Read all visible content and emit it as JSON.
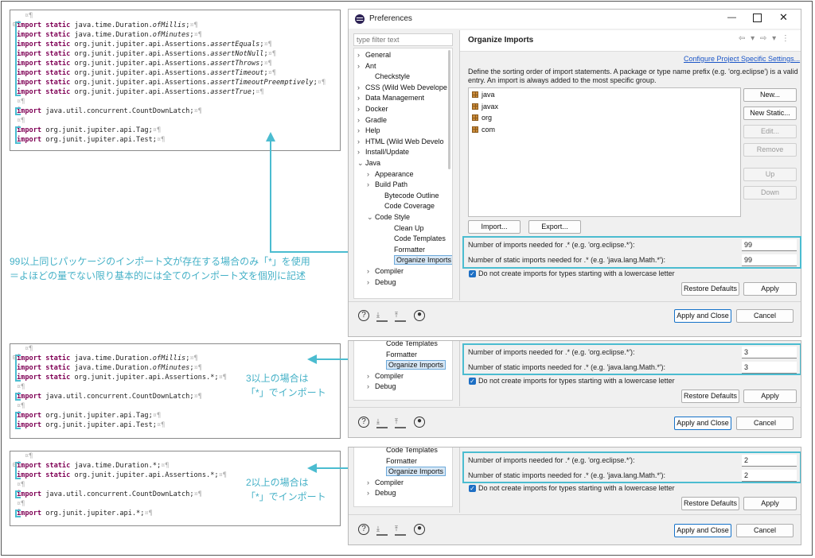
{
  "panels": {
    "p1_lines": [
      {
        "kw": "import",
        "kw2": "static",
        "pre": "java.time.Duration.",
        "it": "ofMillis",
        "post": ";"
      },
      {
        "kw": "import",
        "kw2": "static",
        "pre": "java.time.Duration.",
        "it": "ofMinutes",
        "post": ";"
      },
      {
        "kw": "import",
        "kw2": "static",
        "pre": "org.junit.jupiter.api.Assertions.",
        "it": "assertEquals",
        "post": ";"
      },
      {
        "kw": "import",
        "kw2": "static",
        "pre": "org.junit.jupiter.api.Assertions.",
        "it": "assertNotNull",
        "post": ";"
      },
      {
        "kw": "import",
        "kw2": "static",
        "pre": "org.junit.jupiter.api.Assertions.",
        "it": "assertThrows",
        "post": ";"
      },
      {
        "kw": "import",
        "kw2": "static",
        "pre": "org.junit.jupiter.api.Assertions.",
        "it": "assertTimeout",
        "post": ";"
      },
      {
        "kw": "import",
        "kw2": "static",
        "pre": "org.junit.jupiter.api.Assertions.",
        "it": "assertTimeoutPreemptively",
        "post": ";"
      },
      {
        "kw": "import",
        "kw2": "static",
        "pre": "org.junit.jupiter.api.Assertions.",
        "it": "assertTrue",
        "post": ";"
      },
      {
        "blank": true
      },
      {
        "kw": "import",
        "pre": "java.util.concurrent.CountDownLatch;"
      },
      {
        "blank": true
      },
      {
        "kw": "import",
        "pre": "org.junit.jupiter.api.Tag;"
      },
      {
        "kw": "import",
        "pre": "org.junit.jupiter.api.Test;"
      }
    ],
    "p2_lines": [
      {
        "kw": "import",
        "kw2": "static",
        "pre": "java.time.Duration.",
        "it": "ofMillis",
        "post": ";"
      },
      {
        "kw": "import",
        "kw2": "static",
        "pre": "java.time.Duration.",
        "it": "ofMinutes",
        "post": ";"
      },
      {
        "kw": "import",
        "kw2": "static",
        "pre": "org.junit.jupiter.api.Assertions.*;"
      },
      {
        "blank": true
      },
      {
        "kw": "import",
        "pre": "java.util.concurrent.CountDownLatch;"
      },
      {
        "blank": true
      },
      {
        "kw": "import",
        "pre": "org.junit.jupiter.api.Tag;"
      },
      {
        "kw": "import",
        "pre": "org.junit.jupiter.api.Test;"
      }
    ],
    "p3_lines": [
      {
        "kw": "import",
        "kw2": "static",
        "pre": "java.time.Duration.*;"
      },
      {
        "kw": "import",
        "kw2": "static",
        "pre": "org.junit.jupiter.api.Assertions.*;"
      },
      {
        "blank": true
      },
      {
        "kw": "import",
        "pre": "java.util.concurrent.CountDownLatch;"
      },
      {
        "blank": true
      },
      {
        "kw": "import",
        "pre": "org.junit.jupiter.api.*;"
      }
    ],
    "pilcrow": "¶",
    "cr": "¤¶",
    "minus": "⊟"
  },
  "notes": {
    "note1_line1": "99以上同じパッケージのインポート文が存在する場合のみ「*」を使用",
    "note1_line2": "＝よほどの量でない限り基本的には全てのインポート文を個別に記述",
    "note2_line1": "3以上の場合は",
    "note2_line2": "「*」でインポート",
    "note3_line1": "2以上の場合は",
    "note3_line2": "「*」でインポート"
  },
  "window": {
    "title": "Preferences",
    "filter_placeholder": "type filter text",
    "page_title": "Organize Imports",
    "config_link": "Configure Project Specific Settings...",
    "description": "Define the sorting order of import statements. A package or type name prefix (e.g. 'org.eclipse') is a valid entry. An import is always added to the most specific group.",
    "tree": [
      {
        "label": "General",
        "arrow": "›"
      },
      {
        "label": "Ant",
        "arrow": "›"
      },
      {
        "label": "Checkstyle",
        "arrow": ""
      },
      {
        "label": "CSS (Wild Web Develope",
        "arrow": "›"
      },
      {
        "label": "Data Management",
        "arrow": "›"
      },
      {
        "label": "Docker",
        "arrow": "›"
      },
      {
        "label": "Gradle",
        "arrow": "›"
      },
      {
        "label": "Help",
        "arrow": "›"
      },
      {
        "label": "HTML (Wild Web Develo",
        "arrow": "›"
      },
      {
        "label": "Install/Update",
        "arrow": "›"
      },
      {
        "label": "Java",
        "arrow": "⌄"
      },
      {
        "label": "Appearance",
        "arrow": "›"
      },
      {
        "label": "Build Path",
        "arrow": "›"
      },
      {
        "label": "Bytecode Outline",
        "arrow": ""
      },
      {
        "label": "Code Coverage",
        "arrow": ""
      },
      {
        "label": "Code Style",
        "arrow": "⌄"
      },
      {
        "label": "Clean Up",
        "arrow": ""
      },
      {
        "label": "Code Templates",
        "arrow": ""
      },
      {
        "label": "Formatter",
        "arrow": ""
      },
      {
        "label": "Organize Imports",
        "arrow": ""
      },
      {
        "label": "Compiler",
        "arrow": "›"
      },
      {
        "label": "Debug",
        "arrow": "›"
      }
    ],
    "import_groups": [
      "java",
      "javax",
      "org",
      "com"
    ],
    "side_buttons": {
      "new": "New...",
      "new_static": "New Static...",
      "edit": "Edit...",
      "remove": "Remove",
      "up": "Up",
      "down": "Down"
    },
    "import_btn": "Import...",
    "export_btn": "Export...",
    "imports_label": "Number of imports needed for .* (e.g. 'org.eclipse.*'):",
    "static_label": "Number of static imports needed for .* (e.g. 'java.lang.Math.*'):",
    "lowercase_label": "Do not create imports for types starting with a lowercase letter",
    "restore_defaults": "Restore Defaults",
    "apply": "Apply",
    "apply_close": "Apply and Close",
    "cancel": "Cancel",
    "imports_value": "99",
    "static_value": "99"
  },
  "panel2": {
    "tree": [
      "Code Templates",
      "Formatter",
      "Organize Imports",
      "Compiler",
      "Debug"
    ],
    "imports_value": "3",
    "static_value": "3"
  },
  "panel3": {
    "tree": [
      "Code Templates",
      "Formatter",
      "Organize Imports",
      "Compiler",
      "Debug"
    ],
    "imports_value": "2",
    "static_value": "2"
  },
  "colors": {
    "accent": "#4bbcd0",
    "keyword": "#7f0055",
    "note": "#45b1c7"
  }
}
